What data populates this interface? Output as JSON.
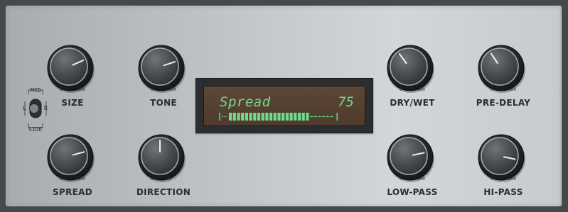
{
  "knobs": [
    {
      "id": "size",
      "label": "SIZE",
      "scale_min": "0",
      "scale_max": "100",
      "value": 0.72
    },
    {
      "id": "tone",
      "label": "TONE",
      "scale_min": "0",
      "scale_max": "100",
      "value": 0.74
    },
    {
      "id": "spread",
      "label": "SPREAD",
      "scale_min": "0",
      "scale_max": "100",
      "value": 0.75
    },
    {
      "id": "direction",
      "label": "DIRECTION",
      "scale_min": "L",
      "scale_max": "R",
      "value": 0.5
    },
    {
      "id": "dry-wet",
      "label": "DRY/WET",
      "scale_min": "0",
      "scale_max": "100",
      "value": 0.38
    },
    {
      "id": "pre-delay",
      "label": "PRE-DELAY",
      "scale_min": "0",
      "scale_max": "100",
      "value": 0.39
    },
    {
      "id": "low-pass",
      "label": "LOW-PASS",
      "scale_min": "0",
      "scale_max": "100",
      "value": 0.76
    },
    {
      "id": "hi-pass",
      "label": "HI-PASS",
      "scale_min": "0",
      "scale_max": "100",
      "value": 0.84
    }
  ],
  "display": {
    "param_name": "Spread",
    "param_value": "75",
    "bar_level": 0.75
  },
  "mode_switch": {
    "top_label": "MID",
    "bottom_label": "SIDE",
    "left_label": "L",
    "right_label": "R",
    "position": "left"
  },
  "colors": {
    "lcd_text": "#6fdc8a",
    "lcd_background": "#574234",
    "panel": "#c4c9cb"
  }
}
